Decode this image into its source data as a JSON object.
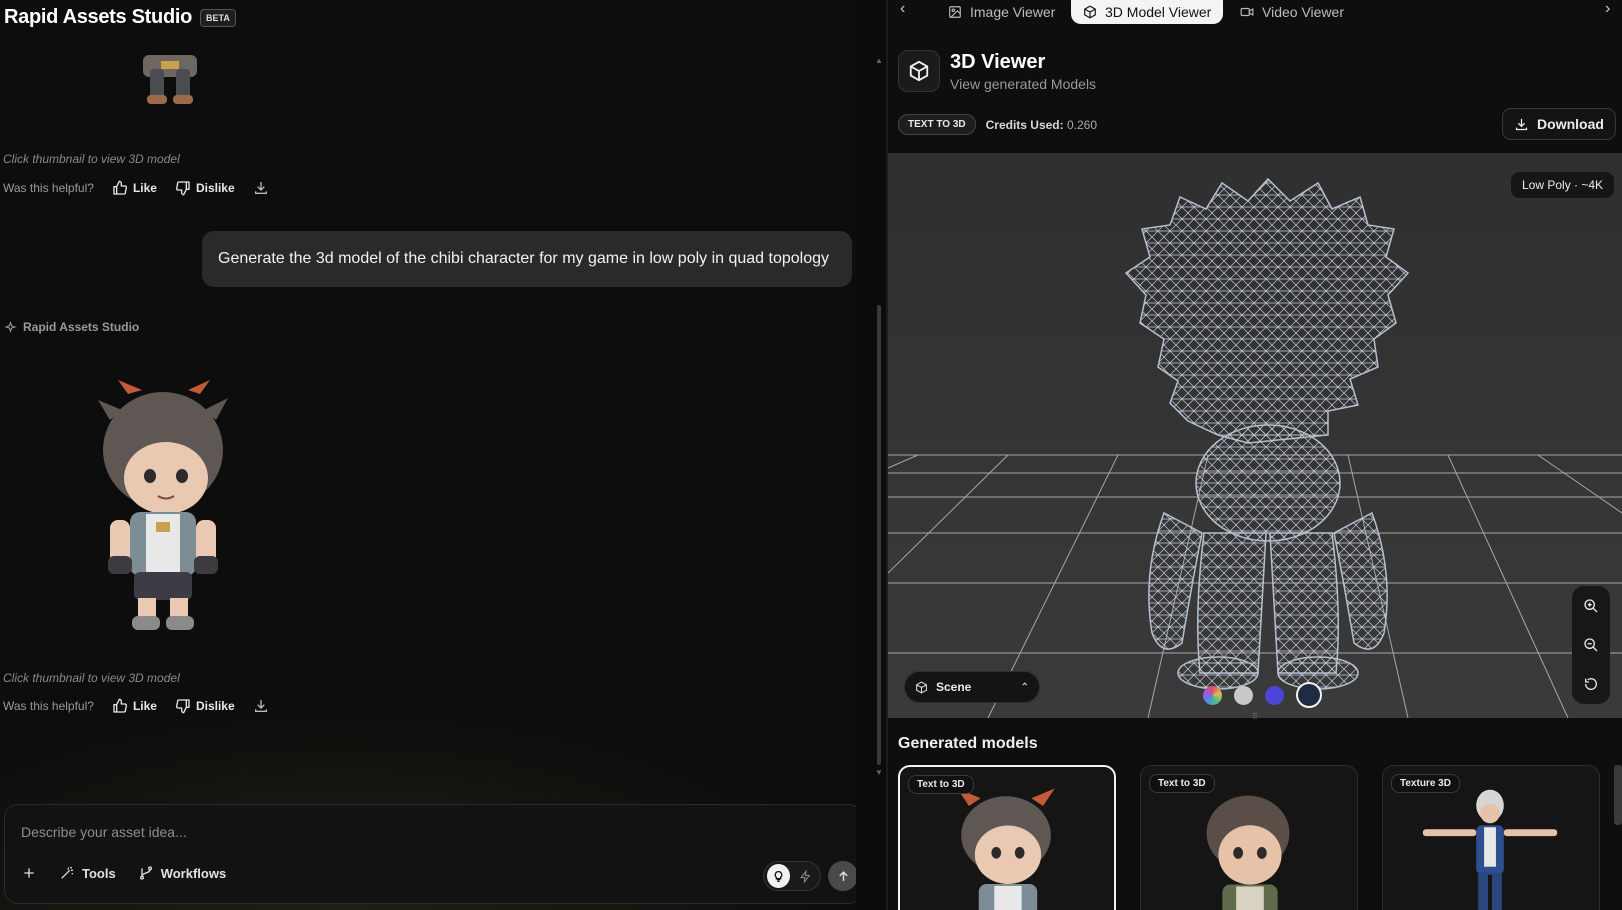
{
  "app": {
    "title": "Rapid Assets Studio",
    "badge": "BETA"
  },
  "chat": {
    "caption": "Click thumbnail to view 3D model",
    "feedback": {
      "question": "Was this helpful?",
      "like": "Like",
      "dislike": "Dislike"
    },
    "user_message": "Generate the 3d model of the chibi character for my game in low poly in quad topology",
    "assistant_name": "Rapid Assets Studio"
  },
  "composer": {
    "placeholder": "Describe your asset idea...",
    "tools": "Tools",
    "workflows": "Workflows"
  },
  "tabs": [
    {
      "label": "Image Viewer",
      "icon": "image-icon",
      "active": false
    },
    {
      "label": "3D Model Viewer",
      "icon": "cube-icon",
      "active": true
    },
    {
      "label": "Video Viewer",
      "icon": "video-icon",
      "active": false
    }
  ],
  "viewer": {
    "title": "3D Viewer",
    "subtitle": "View generated Models",
    "mode_badge": "TEXT TO 3D",
    "credits_label": "Credits Used:",
    "credits_value": "0.260",
    "download": "Download",
    "poly_badge": "Low Poly · ~4K",
    "scene": "Scene",
    "swatches": [
      "#d94f6c",
      "#c8c8c8",
      "#4c46d6",
      "#1f2a44"
    ]
  },
  "generated": {
    "title": "Generated models",
    "cards": [
      {
        "tag": "Text to 3D",
        "selected": true
      },
      {
        "tag": "Text to 3D",
        "selected": false
      },
      {
        "tag": "Texture 3D",
        "selected": false
      }
    ]
  },
  "colors": {
    "accent": "#f4f4f4",
    "panel": "#0e0e0e",
    "bubble": "#2a2a2c",
    "wireframe": "#aeb8c8"
  }
}
